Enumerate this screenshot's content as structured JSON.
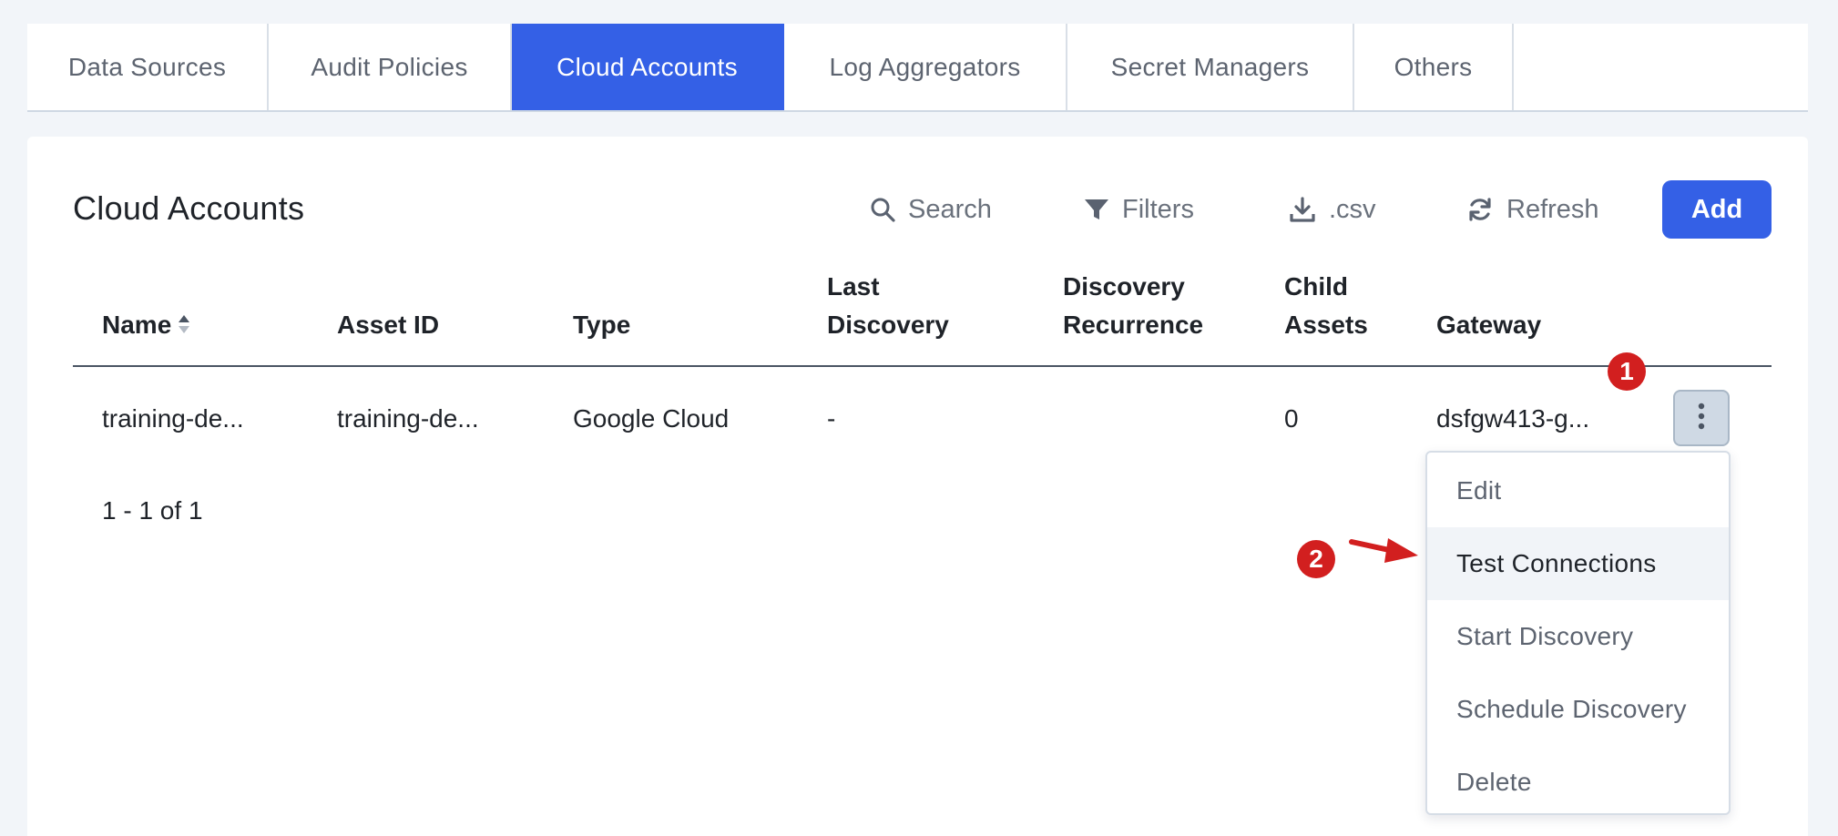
{
  "tabs": [
    {
      "label": "Data Sources",
      "active": false
    },
    {
      "label": "Audit Policies",
      "active": false
    },
    {
      "label": "Cloud Accounts",
      "active": true
    },
    {
      "label": "Log Aggregators",
      "active": false
    },
    {
      "label": "Secret Managers",
      "active": false
    },
    {
      "label": "Others",
      "active": false
    }
  ],
  "card": {
    "title": "Cloud Accounts",
    "toolbar": {
      "search_label": "Search",
      "filters_label": "Filters",
      "csv_label": ".csv",
      "refresh_label": "Refresh",
      "add_label": "Add"
    }
  },
  "table": {
    "columns": {
      "name": "Name",
      "asset_id": "Asset ID",
      "type": "Type",
      "last_discovery": [
        "Last",
        "Discovery"
      ],
      "discovery_recurrence": [
        "Discovery",
        "Recurrence"
      ],
      "child_assets": [
        "Child",
        "Assets"
      ],
      "gateway": "Gateway"
    },
    "rows": [
      {
        "name": "training-de...",
        "asset_id": "training-de...",
        "type": "Google Cloud",
        "last_discovery": "-",
        "discovery_recurrence": "",
        "child_assets": "0",
        "gateway": "dsfgw413-g..."
      }
    ],
    "pagination": "1 - 1 of 1"
  },
  "row_menu": {
    "items": [
      "Edit",
      "Test Connections",
      "Start Discovery",
      "Schedule Discovery",
      "Delete"
    ],
    "highlighted": "Test Connections"
  },
  "annotations": {
    "badge_1": "1",
    "badge_2": "2",
    "color": "#d21f1f"
  },
  "colors": {
    "accent": "#3460e6",
    "background": "#f2f5f9"
  }
}
